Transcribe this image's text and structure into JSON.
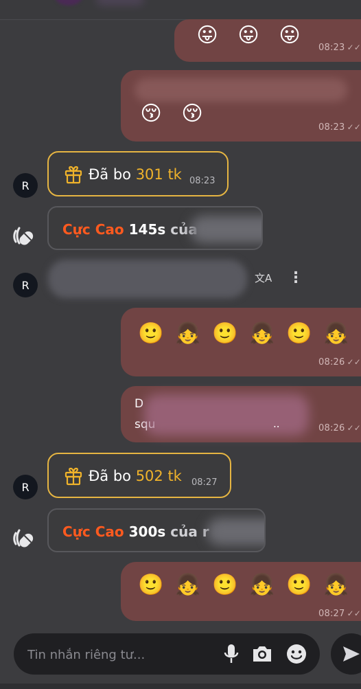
{
  "messages": {
    "m1": {
      "emojis": [
        "😛",
        "😛",
        "😛"
      ],
      "time": "08:23"
    },
    "m2": {
      "emojis": [
        "😚",
        "😚"
      ],
      "time": "08:23"
    },
    "gift1": {
      "avatar": "R",
      "prefix": "Đã bo",
      "amount": "301 tk",
      "time": "08:23"
    },
    "score1": {
      "level": "Cực Cao",
      "seconds": "145s",
      "tail": "của"
    },
    "incoming": {
      "avatar": "R"
    },
    "m3": {
      "emojis": [
        "🙂",
        "👧",
        "🙂",
        "👧",
        "🙂",
        "👧"
      ],
      "time": "08:26"
    },
    "m4": {
      "line1": "D",
      "line2": "squ",
      "line2_end": "..",
      "time": "08:26"
    },
    "gift2": {
      "avatar": "R",
      "prefix": "Đã bo",
      "amount": "502 tk",
      "time": "08:27"
    },
    "score2": {
      "level": "Cực Cao",
      "seconds": "300s",
      "tail": "của r"
    },
    "m5": {
      "emojis": [
        "🙂",
        "👧",
        "🙂",
        "👧",
        "🙂",
        "👧"
      ],
      "time": "08:27"
    }
  },
  "composer": {
    "placeholder": "Tin nhắn riêng tư..."
  },
  "icons": {
    "check": "✓✓",
    "translate_label": "文A",
    "more": "⋮"
  },
  "colors": {
    "outgoing_bubble": "#714444",
    "gift_border": "#e6b542",
    "gift_amount": "#f0b32b",
    "score_level": "#ff5a1f"
  }
}
